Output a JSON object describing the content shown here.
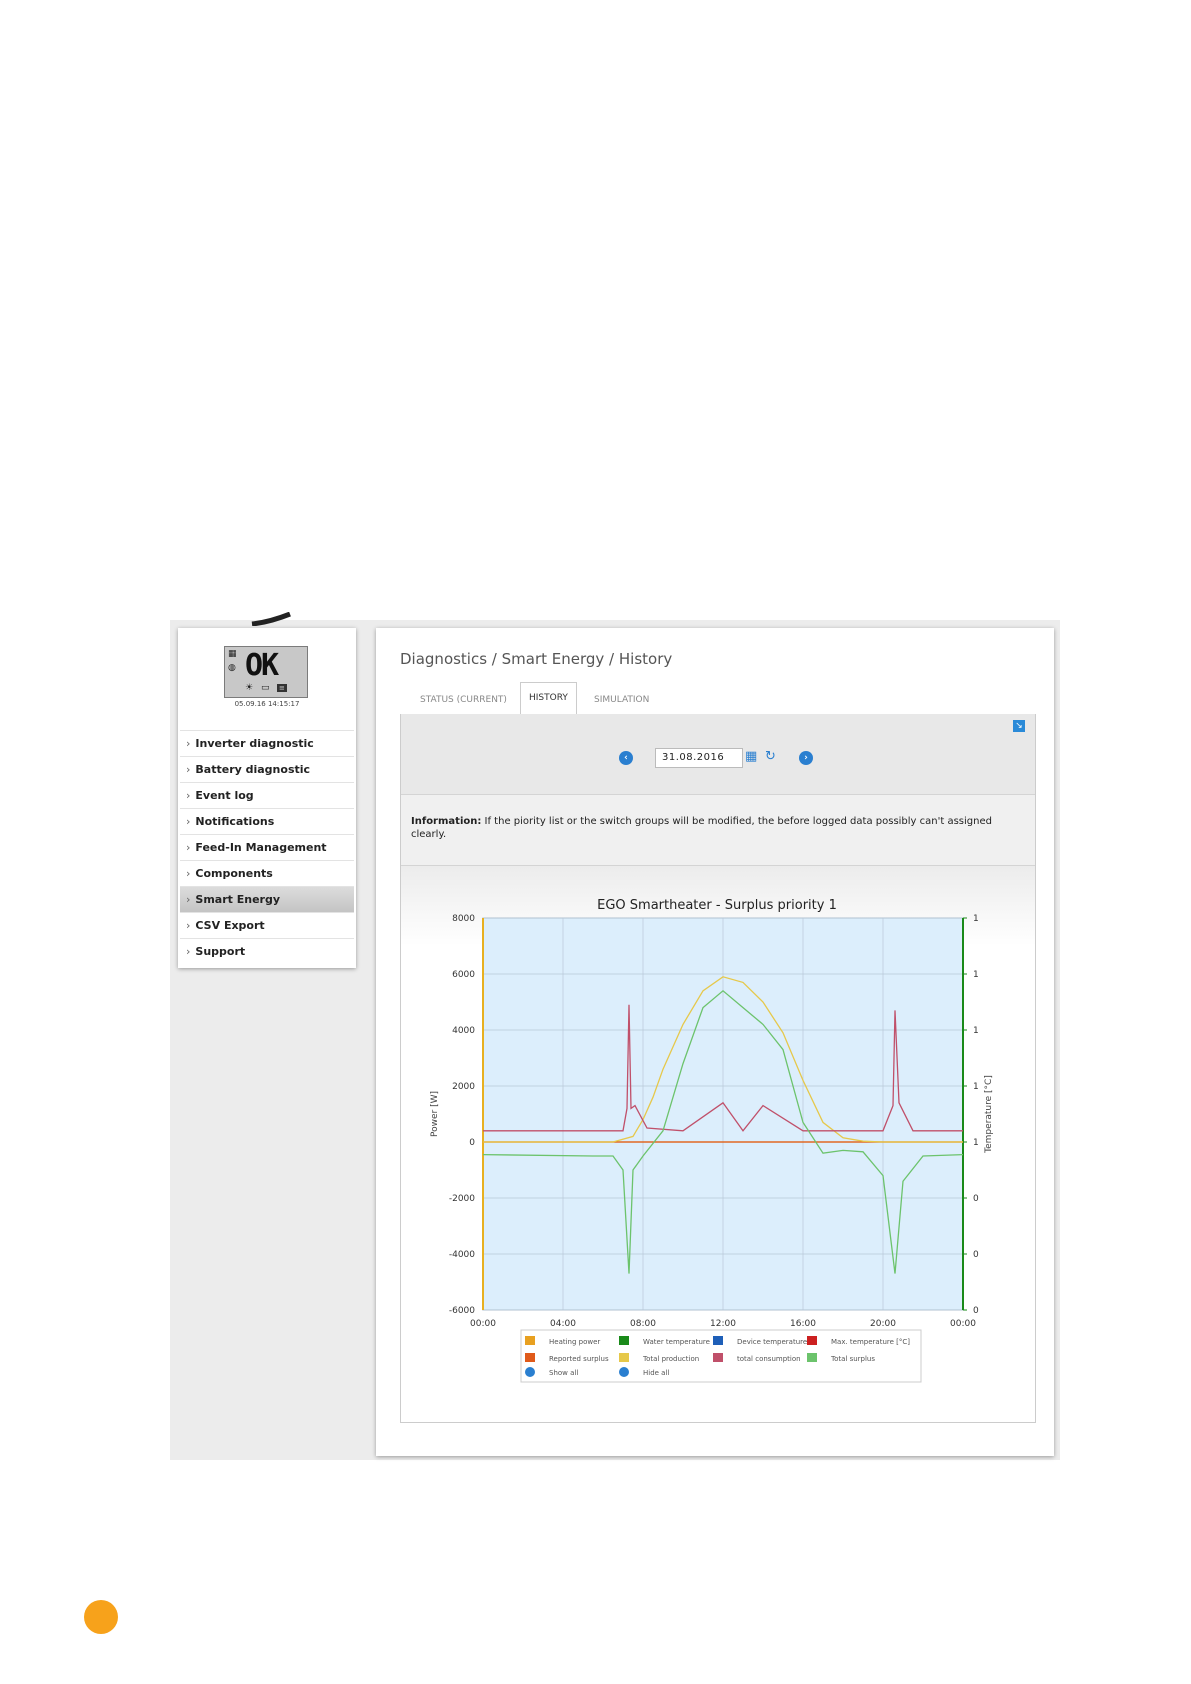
{
  "device": {
    "display_text": "OK",
    "timestamp": "05.09.16 14:15:17"
  },
  "sidebar": {
    "items": [
      {
        "label": "Inverter diagnostic"
      },
      {
        "label": "Battery diagnostic"
      },
      {
        "label": "Event log"
      },
      {
        "label": "Notifications"
      },
      {
        "label": "Feed-In Management"
      },
      {
        "label": "Components"
      },
      {
        "label": "Smart Energy",
        "active": true
      },
      {
        "label": "CSV Export"
      },
      {
        "label": "Support"
      }
    ]
  },
  "page": {
    "title": "Diagnostics / Smart Energy / History"
  },
  "tabs": [
    {
      "label": "STATUS (CURRENT)"
    },
    {
      "label": "HISTORY",
      "active": true
    },
    {
      "label": "SIMULATION"
    }
  ],
  "datebar": {
    "date_value": "31.08.2016",
    "prev_icon": "chevron-left-icon",
    "next_icon": "chevron-right-icon",
    "calendar_icon": "calendar-icon",
    "refresh_icon": "refresh-icon"
  },
  "info": {
    "label": "Information:",
    "text": " If the piority list or the switch groups will be modified, the before logged data possibly can't assigned clearly."
  },
  "colors": {
    "accent": "#2a7fd0",
    "orange_dot": "#f7a21b",
    "plot_bg": "#dceefc"
  },
  "chart_data": {
    "type": "line",
    "title": "EGO Smartheater - Surplus priority 1",
    "ylabel": "Power [W]",
    "y2label": "Temperature [°C]",
    "x_ticks": [
      "00:00",
      "04:00",
      "08:00",
      "12:00",
      "16:00",
      "20:00",
      "00:00"
    ],
    "x_range": [
      0,
      24
    ],
    "y_ticks": [
      8000,
      6000,
      4000,
      2000,
      0,
      -2000,
      -4000,
      -6000
    ],
    "ylim": [
      -6000,
      8000
    ],
    "y2_ticks": [
      "1",
      "1",
      "1",
      "1",
      "1",
      "0",
      "0",
      "0"
    ],
    "grid": true,
    "series": [
      {
        "name": "Heating power",
        "color": "#e8a020",
        "x": [
          0,
          24
        ],
        "y": [
          0,
          0
        ]
      },
      {
        "name": "Reported surplus",
        "color": "#e05a1a",
        "x": [
          0,
          24
        ],
        "y": [
          0,
          0
        ]
      },
      {
        "name": "Total production",
        "color": "#e6c84a",
        "x": [
          0,
          6.5,
          7.5,
          8,
          8.5,
          9,
          10,
          11,
          12,
          13,
          14,
          15,
          16,
          17,
          18,
          19,
          20,
          24
        ],
        "y": [
          0,
          0,
          200,
          800,
          1600,
          2600,
          4200,
          5400,
          5900,
          5700,
          5000,
          3900,
          2200,
          700,
          150,
          30,
          0,
          0
        ]
      },
      {
        "name": "total consumption",
        "color": "#c0506a",
        "x": [
          0,
          7,
          7.2,
          7.3,
          7.4,
          7.6,
          8.2,
          10,
          12,
          13,
          14,
          16,
          20,
          20.5,
          20.6,
          20.8,
          21.5,
          24
        ],
        "y": [
          400,
          400,
          1200,
          4900,
          1200,
          1300,
          500,
          400,
          1400,
          400,
          1300,
          400,
          400,
          1300,
          4700,
          1400,
          400,
          400
        ]
      },
      {
        "name": "Total surplus",
        "color": "#6cc36c",
        "x": [
          0,
          5.5,
          6.5,
          7,
          7.3,
          7.5,
          8,
          9,
          10,
          11,
          12,
          13,
          14,
          15,
          16,
          17,
          18,
          19,
          20,
          20.6,
          21,
          22,
          24
        ],
        "y": [
          -450,
          -500,
          -500,
          -1000,
          -4700,
          -1000,
          -500,
          400,
          2800,
          4800,
          5400,
          4800,
          4200,
          3300,
          700,
          -400,
          -300,
          -350,
          -1200,
          -4700,
          -1400,
          -500,
          -450
        ]
      }
    ],
    "legend": {
      "placement": "bottom",
      "entries": [
        {
          "name": "Heating power",
          "color": "#e8a020"
        },
        {
          "name": "Water temperature",
          "color": "#1a8a1a"
        },
        {
          "name": "Device temperature",
          "color": "#1e5fb8"
        },
        {
          "name": "Max. temperature [°C]",
          "color": "#cc2020"
        },
        {
          "name": "Reported surplus",
          "color": "#e05a1a"
        },
        {
          "name": "Total production",
          "color": "#e6c84a"
        },
        {
          "name": "total consumption",
          "color": "#c0506a"
        },
        {
          "name": "Total surplus",
          "color": "#6cc36c"
        }
      ],
      "show_all": "Show all",
      "hide_all": "Hide all"
    }
  }
}
